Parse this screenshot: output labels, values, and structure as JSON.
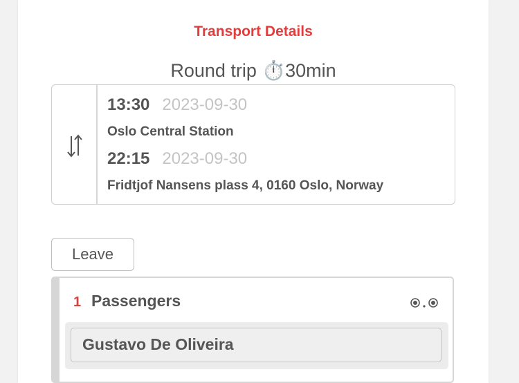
{
  "header": {
    "title": "Transport Details",
    "trip_type": "Round trip",
    "duration_icon": "stopwatch-icon",
    "duration_glyph": "⏱️",
    "duration": "30min"
  },
  "trip": {
    "swap_icon": "swap-vertical-icon",
    "outbound": {
      "time": "13:30",
      "date": "2023-09-30",
      "place": "Oslo Central Station"
    },
    "return": {
      "time": "22:15",
      "date": "2023-09-30",
      "place": "Fridtjof Nansens plass 4, 0160 Oslo, Norway"
    }
  },
  "actions": {
    "leave_label": "Leave"
  },
  "passengers": {
    "count": "1",
    "label": "Passengers",
    "menu_icon": "dots-icon",
    "items": [
      {
        "name": "Gustavo De Oliveira"
      }
    ]
  },
  "colors": {
    "accent": "#e23d3d",
    "text": "#555555",
    "muted": "#c4c4c4",
    "border": "#d6d6d6"
  }
}
